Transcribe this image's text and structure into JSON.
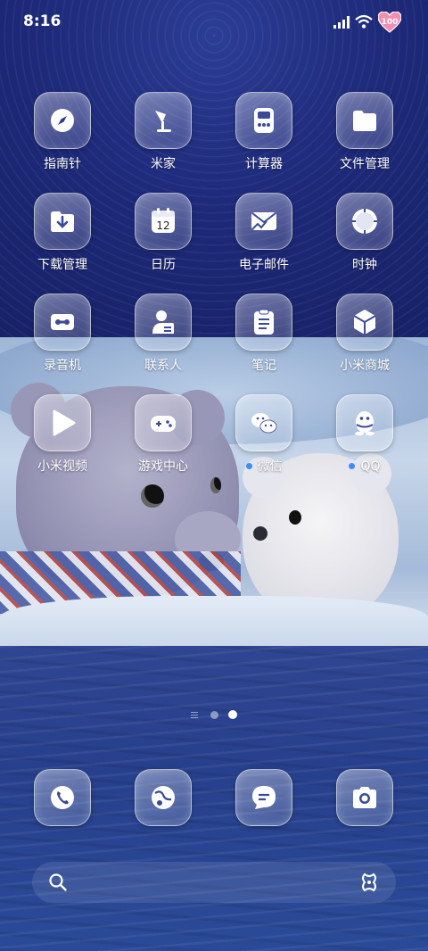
{
  "status_bar": {
    "time": "8:16",
    "battery_level": "100",
    "icons": [
      "signal-icon",
      "wifi-icon",
      "battery-heart-icon"
    ]
  },
  "apps": [
    {
      "label": "指南针",
      "icon": "compass-icon",
      "notification": false
    },
    {
      "label": "米家",
      "icon": "mijia-lamp-icon",
      "notification": false
    },
    {
      "label": "计算器",
      "icon": "calculator-icon",
      "notification": false
    },
    {
      "label": "文件管理",
      "icon": "folder-icon",
      "notification": false
    },
    {
      "label": "下载管理",
      "icon": "download-icon",
      "notification": false
    },
    {
      "label": "日历",
      "icon": "calendar-icon",
      "day": "12",
      "notification": false
    },
    {
      "label": "电子邮件",
      "icon": "email-icon",
      "notification": false
    },
    {
      "label": "时钟",
      "icon": "clock-icon",
      "notification": false
    },
    {
      "label": "录音机",
      "icon": "recorder-icon",
      "notification": false
    },
    {
      "label": "联系人",
      "icon": "contacts-icon",
      "notification": false
    },
    {
      "label": "笔记",
      "icon": "notes-icon",
      "notification": false
    },
    {
      "label": "小米商城",
      "icon": "mi-store-icon",
      "notification": false
    },
    {
      "label": "小米视频",
      "icon": "video-play-icon",
      "notification": false
    },
    {
      "label": "游戏中心",
      "icon": "gamepad-icon",
      "notification": false
    },
    {
      "label": "微信",
      "icon": "wechat-icon",
      "notification": true
    },
    {
      "label": "QQ",
      "icon": "qq-penguin-icon",
      "notification": true
    }
  ],
  "page_indicator": {
    "pages": 3,
    "active": 2
  },
  "dock": [
    "phone-icon",
    "browser-icon",
    "messages-icon",
    "camera-icon"
  ],
  "search_bar": {
    "icons": [
      "search-icon",
      "scan-icon"
    ]
  },
  "colors": {
    "notification_dot": "#3f8cff",
    "sky": "#1e2a7a",
    "sea": "#2a4590"
  }
}
